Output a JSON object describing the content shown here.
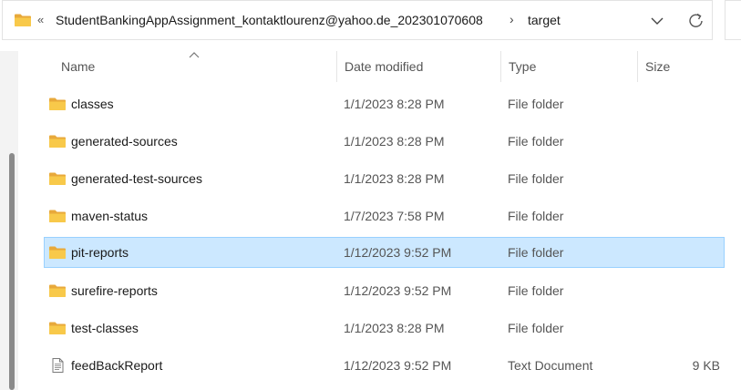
{
  "address_bar": {
    "overflow_glyph": "«",
    "path": "StudentBankingAppAssignment_kontaktlourenz@yahoo.de_202301070608",
    "separator": "›",
    "current": "target"
  },
  "columns": {
    "name": "Name",
    "date": "Date modified",
    "type": "Type",
    "size": "Size"
  },
  "files": [
    {
      "name": "classes",
      "date": "1/1/2023 8:28 PM",
      "type": "File folder",
      "size": "",
      "icon": "folder-icon",
      "selected": false
    },
    {
      "name": "generated-sources",
      "date": "1/1/2023 8:28 PM",
      "type": "File folder",
      "size": "",
      "icon": "folder-icon",
      "selected": false
    },
    {
      "name": "generated-test-sources",
      "date": "1/1/2023 8:28 PM",
      "type": "File folder",
      "size": "",
      "icon": "folder-icon",
      "selected": false
    },
    {
      "name": "maven-status",
      "date": "1/7/2023 7:58 PM",
      "type": "File folder",
      "size": "",
      "icon": "folder-icon",
      "selected": false
    },
    {
      "name": "pit-reports",
      "date": "1/12/2023 9:52 PM",
      "type": "File folder",
      "size": "",
      "icon": "folder-icon",
      "selected": true
    },
    {
      "name": "surefire-reports",
      "date": "1/12/2023 9:52 PM",
      "type": "File folder",
      "size": "",
      "icon": "folder-icon",
      "selected": false
    },
    {
      "name": "test-classes",
      "date": "1/1/2023 8:28 PM",
      "type": "File folder",
      "size": "",
      "icon": "folder-icon",
      "selected": false
    },
    {
      "name": "feedBackReport",
      "date": "1/12/2023 9:52 PM",
      "type": "Text Document",
      "size": "9 KB",
      "icon": "text-document-icon",
      "selected": false
    }
  ],
  "colors": {
    "selection_bg": "#cce8ff",
    "selection_border": "#99d1ff",
    "folder_yellow": "#f8c94a"
  }
}
